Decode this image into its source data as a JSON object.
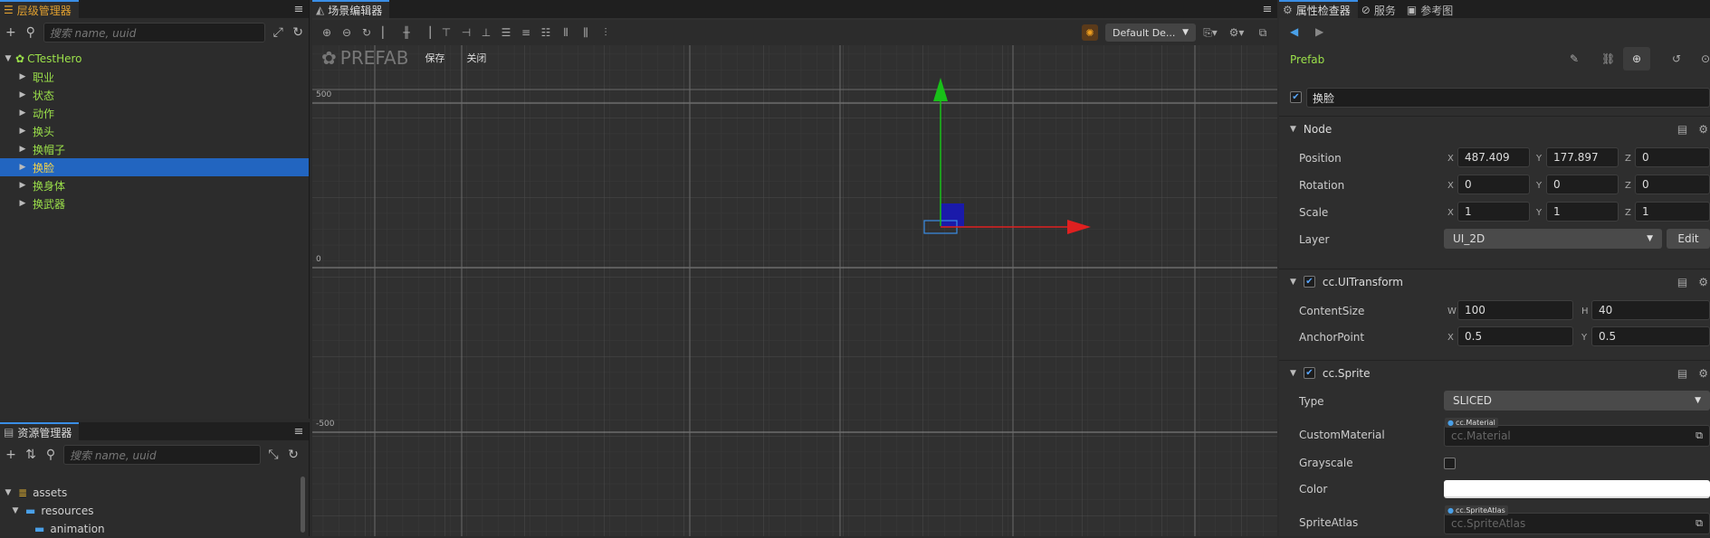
{
  "hierarchy": {
    "tab_label": "层级管理器",
    "search_placeholder": "搜索 name, uuid",
    "root": "CTestHero",
    "items": [
      "职业",
      "状态",
      "动作",
      "换头",
      "换帽子",
      "换脸",
      "换身体",
      "换武器"
    ],
    "selected_index": 5
  },
  "assets": {
    "tab_label": "资源管理器",
    "search_placeholder": "搜索 name, uuid",
    "items": [
      "assets",
      "resources",
      "animation"
    ]
  },
  "scene": {
    "tab_label": "场景编辑器",
    "camera_dropdown": "Default De...",
    "prefab_label": "PREFAB",
    "save_label": "保存",
    "close_label": "关闭",
    "ruler_labels": [
      "500",
      "0",
      "-500"
    ]
  },
  "inspector": {
    "tabs": [
      "属性检查器",
      "服务",
      "参考图"
    ],
    "prefab_label": "Prefab",
    "node_name": "换脸",
    "node_section": "Node",
    "position_label": "Position",
    "position": {
      "x": "487.409",
      "y": "177.897",
      "z": "0"
    },
    "rotation_label": "Rotation",
    "rotation": {
      "x": "0",
      "y": "0",
      "z": "0"
    },
    "scale_label": "Scale",
    "scale": {
      "x": "1",
      "y": "1",
      "z": "1"
    },
    "layer_label": "Layer",
    "layer_value": "UI_2D",
    "edit_label": "Edit",
    "uitransform_section": "cc.UITransform",
    "contentsize_label": "ContentSize",
    "contentsize": {
      "w": "100",
      "h": "40"
    },
    "anchor_label": "AnchorPoint",
    "anchor": {
      "x": "0.5",
      "y": "0.5"
    },
    "sprite_section": "cc.Sprite",
    "type_label": "Type",
    "type_value": "SLICED",
    "custommaterial_label": "CustomMaterial",
    "custommaterial_tag": "cc.Material",
    "custommaterial_value": "cc.Material",
    "grayscale_label": "Grayscale",
    "color_label": "Color",
    "color_value": "#ffffff",
    "spriteatlas_label": "SpriteAtlas",
    "spriteatlas_tag": "cc.SpriteAtlas",
    "spriteatlas_value": "cc.SpriteAtlas"
  },
  "colors": {
    "accent": "#2265c0",
    "tree_green": "#9be04a",
    "selected_text": "#f3d34a",
    "gizmo_x": "#e02020",
    "gizmo_y": "#18c018"
  },
  "axis_letters": {
    "x": "X",
    "y": "Y",
    "z": "Z",
    "w": "W",
    "h": "H"
  }
}
